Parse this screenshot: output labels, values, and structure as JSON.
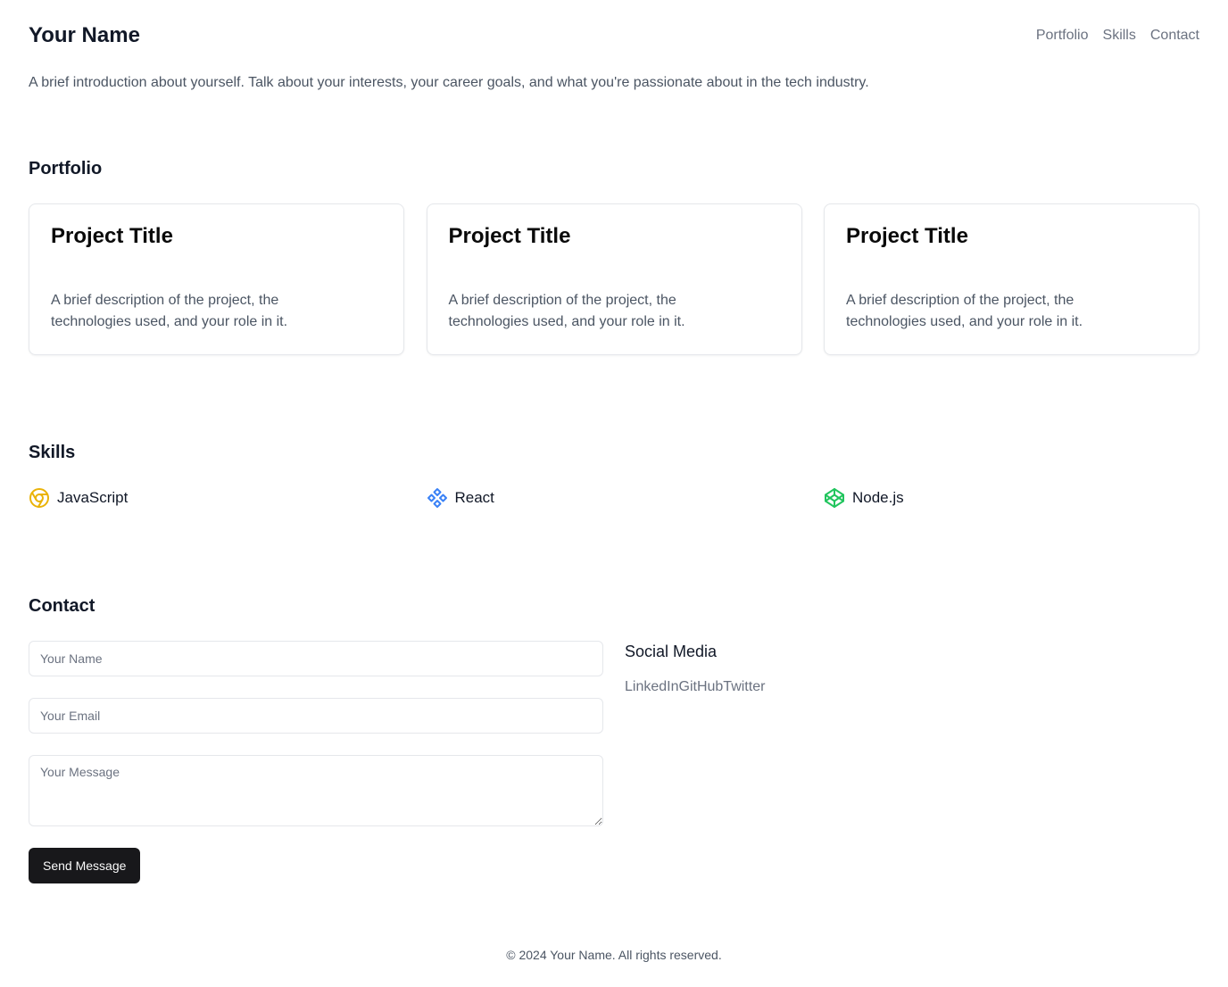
{
  "header": {
    "brand": "Your Name",
    "nav": [
      "Portfolio",
      "Skills",
      "Contact"
    ]
  },
  "intro": "A brief introduction about yourself. Talk about your interests, your career goals, and what you're passionate about in the tech industry.",
  "portfolio": {
    "title": "Portfolio",
    "projects": [
      {
        "title": "Project Title",
        "description": "A brief description of the project, the technologies used, and your role in it."
      },
      {
        "title": "Project Title",
        "description": "A brief description of the project, the technologies used, and your role in it."
      },
      {
        "title": "Project Title",
        "description": "A brief description of the project, the technologies used, and your role in it."
      }
    ]
  },
  "skills": {
    "title": "Skills",
    "items": [
      {
        "label": "JavaScript",
        "icon": "chrome-icon",
        "color": "#eab308"
      },
      {
        "label": "React",
        "icon": "component-icon",
        "color": "#3b82f6"
      },
      {
        "label": "Node.js",
        "icon": "codepen-icon",
        "color": "#22c55e"
      }
    ]
  },
  "contact": {
    "title": "Contact",
    "name_placeholder": "Your Name",
    "email_placeholder": "Your Email",
    "message_placeholder": "Your Message",
    "send_label": "Send Message",
    "social_title": "Social Media",
    "social_links": [
      "LinkedIn",
      "GitHub",
      "Twitter"
    ]
  },
  "footer": "© 2024 Your Name. All rights reserved."
}
